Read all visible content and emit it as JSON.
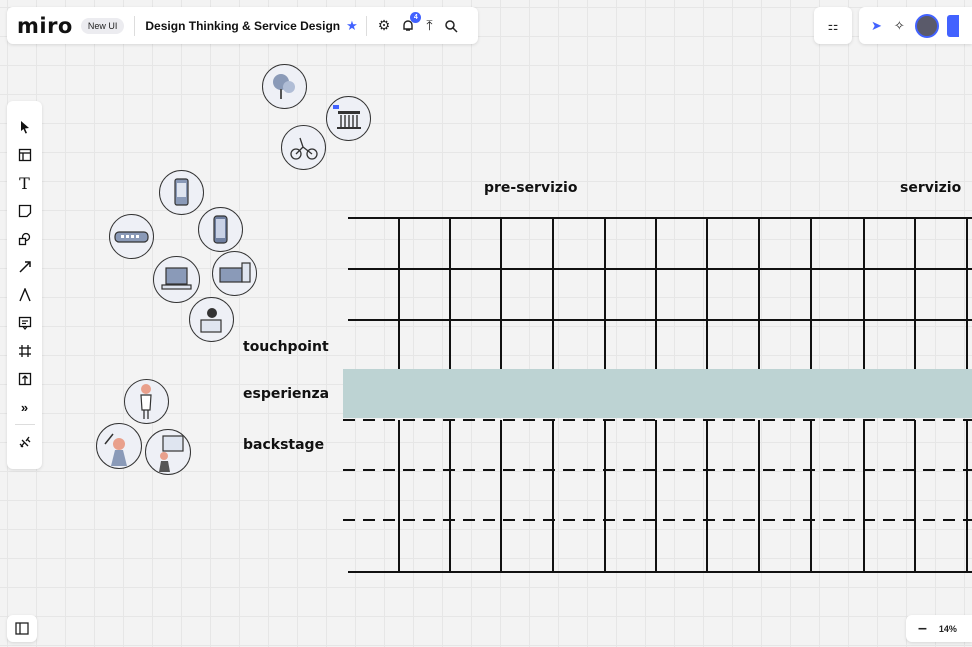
{
  "app": {
    "logo": "miro",
    "badge": "New UI",
    "board_title": "Design Thinking & Service Design",
    "notifications_count": "4",
    "zoom": "14%"
  },
  "toolbar_icons": [
    "star-icon",
    "settings-icon",
    "notifications-icon",
    "upload-icon",
    "search-icon"
  ],
  "right_tools": [
    "templates-icon",
    "cursor-icon",
    "celebrate-icon",
    "avatar",
    "share-button"
  ],
  "sidebar_tools": [
    "select-icon",
    "frame-template-icon",
    "text-icon",
    "sticky-note-icon",
    "shapes-icon",
    "arrow-icon",
    "pen-icon",
    "comment-icon",
    "frame-icon",
    "upload-icon",
    "more-icon",
    "apps-icon"
  ],
  "board": {
    "col_labels": {
      "pre_service": "pre-servizio",
      "service": "servizio"
    },
    "row_labels": {
      "touchpoint": "touchpoint",
      "experience": "esperienza",
      "backstage": "backstage"
    }
  },
  "colors": {
    "accent": "#4262ff",
    "band": "#bdd3d3",
    "canvas": "#f3f3f3"
  }
}
